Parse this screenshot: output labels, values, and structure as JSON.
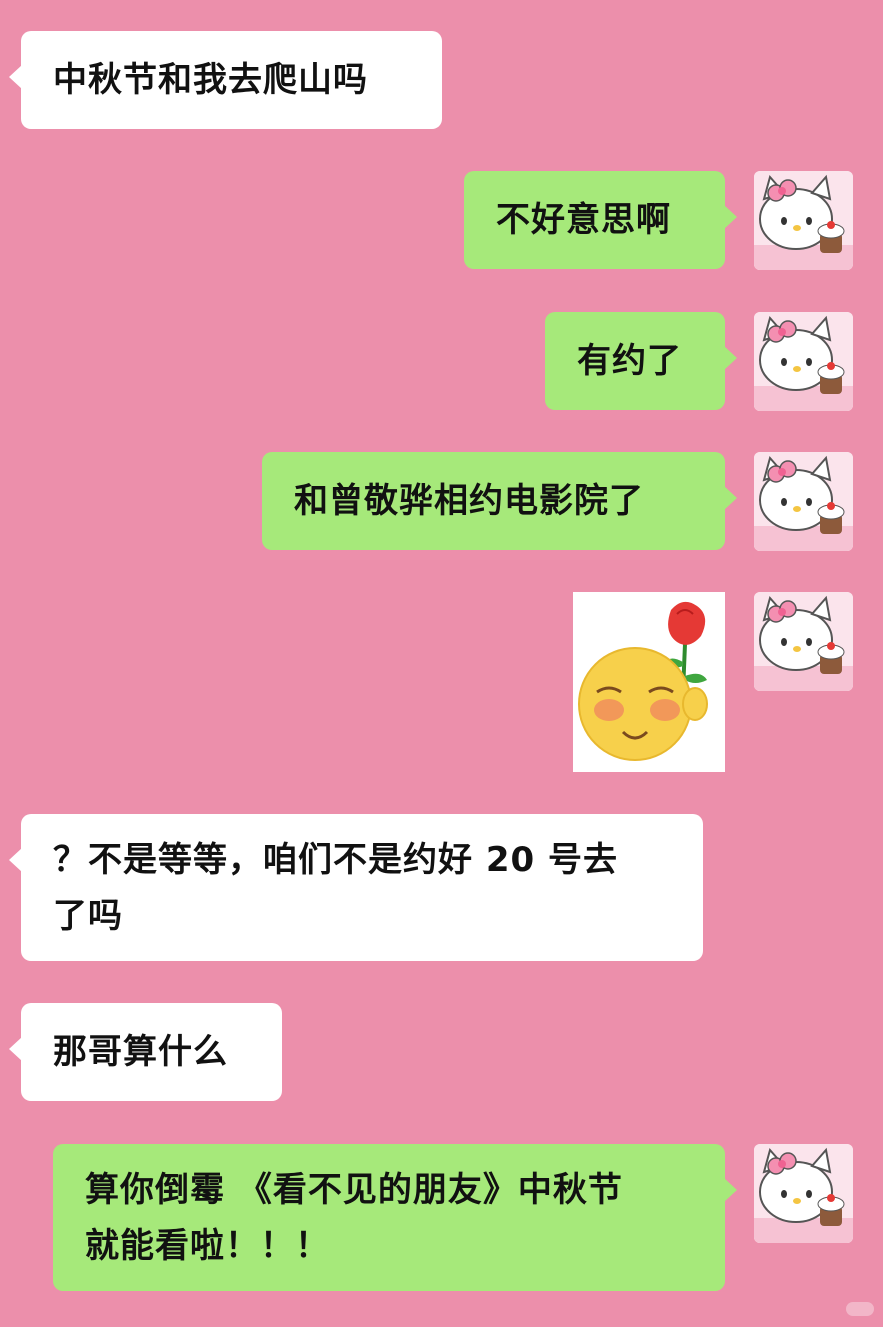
{
  "messages": [
    {
      "side": "left",
      "text": "中秋节和我去爬山吗"
    },
    {
      "side": "right",
      "text": "不好意思啊"
    },
    {
      "side": "right",
      "text": "有约了"
    },
    {
      "side": "right",
      "text": "和曾敬骅相约电影院了"
    },
    {
      "side": "right",
      "type": "sticker",
      "sticker": "blushing-emoji-with-rose"
    },
    {
      "side": "left",
      "lines": [
        "？不是等等，咱们不是约好 20 号去",
        "了吗"
      ]
    },
    {
      "side": "left",
      "text": "那哥算什么"
    },
    {
      "side": "right",
      "lines": [
        "算你倒霉 《看不见的朋友》中秋节",
        "就能看啦！！！"
      ]
    }
  ],
  "avatar": {
    "icon": "hello-kitty-avatar"
  },
  "colors": {
    "background": "#EC8FAB",
    "incoming_bubble": "#FFFFFF",
    "outgoing_bubble": "#A6E97A"
  }
}
